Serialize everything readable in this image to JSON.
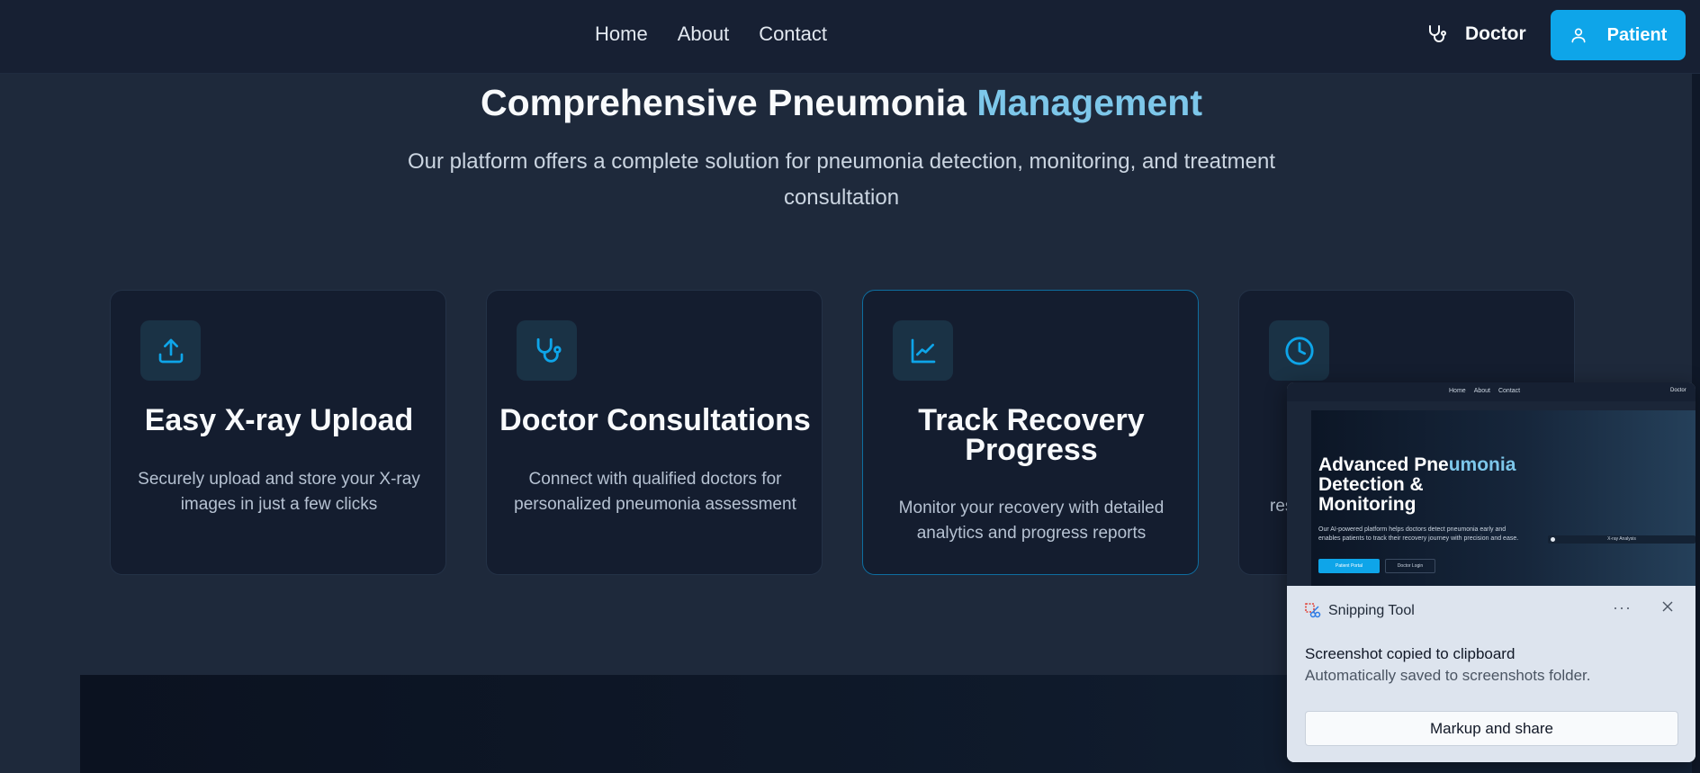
{
  "nav": {
    "links": [
      "Home",
      "About",
      "Contact"
    ],
    "doctor_label": "Doctor",
    "patient_label": "Patient"
  },
  "section": {
    "heading_main": "Comprehensive Pneumonia ",
    "heading_accent": "Management",
    "subheading": "Our platform offers a complete solution for pneumonia detection, monitoring, and treatment consultation"
  },
  "cards": [
    {
      "icon": "upload-icon",
      "title": "Easy X-ray Upload",
      "text": "Securely upload and store your X-ray images in just a few clicks"
    },
    {
      "icon": "stethoscope-icon",
      "title": "Doctor Consultations",
      "text": "Connect with qualified doctors for personalized pneumonia assessment"
    },
    {
      "icon": "line-chart-icon",
      "title": "Track Recovery Progress",
      "text": "Monitor your recovery with detailed analytics and progress reports"
    },
    {
      "icon": "clock-icon",
      "title": "",
      "text": "res"
    }
  ],
  "toast": {
    "app_name": "Snipping Tool",
    "more_label": "···",
    "title": "Screenshot copied to clipboard",
    "subtitle": "Automatically saved to screenshots folder.",
    "action_label": "Markup and share",
    "preview": {
      "nav_links": [
        "Home",
        "About",
        "Contact"
      ],
      "nav_right": "Doctor",
      "title_line1_main": "Advanced Pne",
      "title_line1_accent": "umonia",
      "title_line2": "Detection &",
      "title_line3": "Monitoring",
      "description": "Our AI-powered platform helps doctors detect pneumonia early and enables patients to track their recovery journey with precision and ease.",
      "primary_button": "Patient Portal",
      "secondary_button": "Doctor Login",
      "badge": "X-ray Analysis"
    }
  },
  "colors": {
    "background": "#1e293b",
    "nav": "#172033",
    "accent": "#0ea5e9",
    "heading_accent": "#7dc7ea",
    "card_bg": "#141d2f"
  }
}
